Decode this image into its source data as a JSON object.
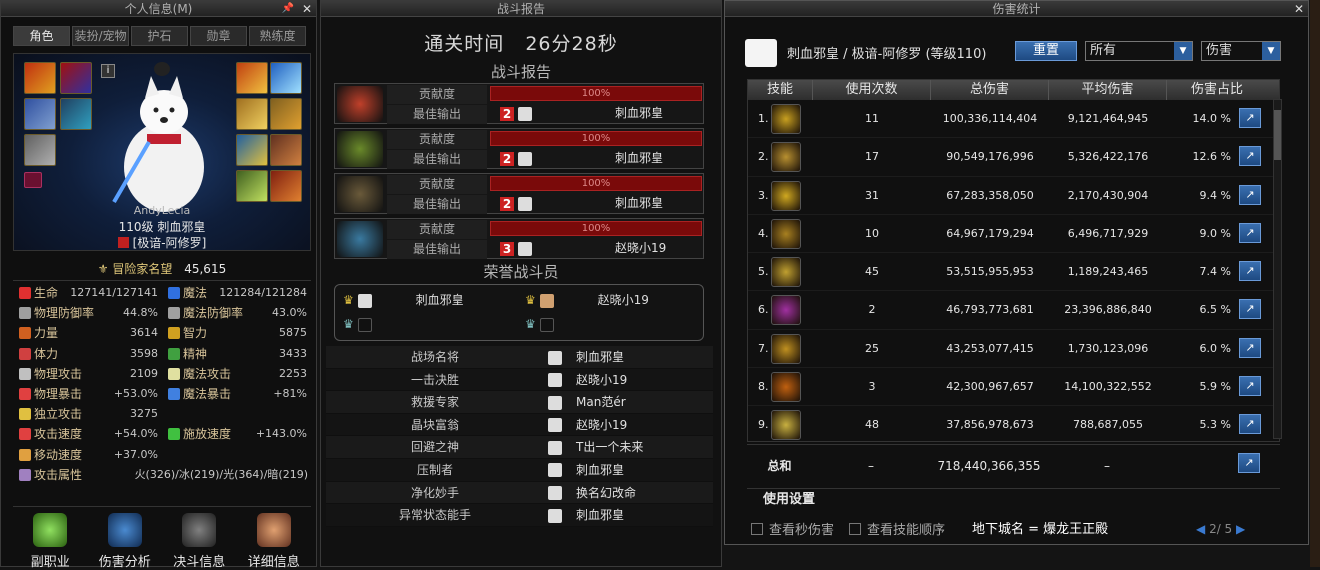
{
  "left": {
    "title": "个人信息(M)",
    "tabs": [
      "角色",
      "装扮/宠物",
      "护石",
      "勋章",
      "熟练度"
    ],
    "char_name": "AndyLecia",
    "level_class": "110级 刺血邪皇",
    "title_badge": "[极谙-阿修罗]",
    "fame_label": "冒险家名望",
    "fame_value": "45,615",
    "stats": [
      {
        "l": "生命",
        "v": "127141/127141",
        "color": "#e03030",
        "r": "魔法",
        "rv": "121284/121284",
        "rcolor": "#3070e0"
      },
      {
        "l": "物理防御率",
        "v": "44.8%",
        "color": "#a0a0a0",
        "r": "魔法防御率",
        "rv": "43.0%",
        "rcolor": "#a0a0a0"
      },
      {
        "l": "力量",
        "v": "3614",
        "color": "#d06020",
        "r": "智力",
        "rv": "5875",
        "rcolor": "#d0a020"
      },
      {
        "l": "体力",
        "v": "3598",
        "color": "#d04040",
        "r": "精神",
        "rv": "3433",
        "rcolor": "#40a040"
      },
      {
        "l": "物理攻击",
        "v": "2109",
        "color": "#c0c0c0",
        "r": "魔法攻击",
        "rv": "2253",
        "rcolor": "#e0e0a0"
      },
      {
        "l": "物理暴击",
        "v": "+53.0%",
        "color": "#e04040",
        "r": "魔法暴击",
        "rv": "+81%",
        "rcolor": "#4080e0"
      },
      {
        "l": "独立攻击",
        "v": "3275",
        "color": "#e0c040",
        "r": "",
        "rv": "",
        "rcolor": ""
      },
      {
        "l": "攻击速度",
        "v": "+54.0%",
        "color": "#e04040",
        "r": "施放速度",
        "rv": "+143.0%",
        "rcolor": "#40c040"
      },
      {
        "l": "移动速度",
        "v": "+37.0%",
        "color": "#e0a040",
        "r": "",
        "rv": "",
        "rcolor": ""
      },
      {
        "l": "攻击属性",
        "v": "火(326)/冰(219)/光(364)/暗(219)",
        "color": "#a080c0",
        "r": "",
        "rv": "",
        "rcolor": ""
      }
    ],
    "bottom_buttons": [
      "副职业",
      "伤害分析",
      "决斗信息",
      "详细信息"
    ]
  },
  "mid": {
    "title": "战斗报告",
    "clear_time_label": "通关时间",
    "clear_time_value": "26分28秒",
    "report_heading": "战斗报告",
    "rows": [
      {
        "contrib": "贡献度",
        "pct": "100%",
        "best": "最佳输出",
        "rank": "2",
        "name": "刺血邪皇",
        "color": "#c0402a"
      },
      {
        "contrib": "贡献度",
        "pct": "100%",
        "best": "最佳输出",
        "rank": "2",
        "name": "刺血邪皇",
        "color": "#6a8a2a"
      },
      {
        "contrib": "贡献度",
        "pct": "100%",
        "best": "最佳输出",
        "rank": "2",
        "name": "刺血邪皇",
        "color": "#6a5a3a"
      },
      {
        "contrib": "贡献度",
        "pct": "100%",
        "best": "最佳输出",
        "rank": "3",
        "name": "赵晓小19",
        "color": "#3a7aa0"
      }
    ],
    "honor_heading": "荣誉战斗员",
    "honor": [
      "刺血邪皇",
      "赵晓小19"
    ],
    "awards": [
      {
        "a": "战场名将",
        "w": "刺血邪皇"
      },
      {
        "a": "一击决胜",
        "w": "赵晓小19"
      },
      {
        "a": "救援专家",
        "w": "Man范ér"
      },
      {
        "a": "晶块富翁",
        "w": "赵晓小19"
      },
      {
        "a": "回避之神",
        "w": "T出一个未来"
      },
      {
        "a": "压制者",
        "w": "刺血邪皇"
      },
      {
        "a": "净化妙手",
        "w": "换名幻改命"
      },
      {
        "a": "异常状态能手",
        "w": "刺血邪皇"
      }
    ]
  },
  "right": {
    "title": "伤害统计",
    "player": "刺血邪皇 / 极谙-阿修罗 (等级110)",
    "reset": "重置",
    "filter1": "所有",
    "filter2": "伤害",
    "columns": [
      "技能",
      "使用次数",
      "总伤害",
      "平均伤害",
      "伤害占比"
    ],
    "rows": [
      {
        "n": "1.",
        "uses": "11",
        "total": "100,336,114,404",
        "avg": "9,121,464,945",
        "pct": "14.0 %",
        "c": "#c8a020"
      },
      {
        "n": "2.",
        "uses": "17",
        "total": "90,549,176,996",
        "avg": "5,326,422,176",
        "pct": "12.6 %",
        "c": "#b89030"
      },
      {
        "n": "3.",
        "uses": "31",
        "total": "67,283,358,050",
        "avg": "2,170,430,904",
        "pct": "9.4 %",
        "c": "#d0a820"
      },
      {
        "n": "4.",
        "uses": "10",
        "total": "64,967,179,294",
        "avg": "6,496,717,929",
        "pct": "9.0 %",
        "c": "#a88020"
      },
      {
        "n": "5.",
        "uses": "45",
        "total": "53,515,955,953",
        "avg": "1,189,243,465",
        "pct": "7.4 %",
        "c": "#c0a030"
      },
      {
        "n": "6.",
        "uses": "2",
        "total": "46,793,773,681",
        "avg": "23,396,886,840",
        "pct": "6.5 %",
        "c": "#a030a0"
      },
      {
        "n": "7.",
        "uses": "25",
        "total": "43,253,077,415",
        "avg": "1,730,123,096",
        "pct": "6.0 %",
        "c": "#c09020"
      },
      {
        "n": "8.",
        "uses": "3",
        "total": "42,300,967,657",
        "avg": "14,100,322,552",
        "pct": "5.9 %",
        "c": "#c06010"
      },
      {
        "n": "9.",
        "uses": "48",
        "total": "37,856,978,673",
        "avg": "788,687,055",
        "pct": "5.3 %",
        "c": "#c8b040"
      }
    ],
    "total_label": "总和",
    "total_uses": "–",
    "total_value": "718,440,366,355",
    "total_avg": "–",
    "usage_label": "使用设置",
    "check1": "查看秒伤害",
    "check2": "查看技能顺序"
  },
  "dungeon": "地下城名 = 爆龙王正殿",
  "pager": "2/ 5"
}
